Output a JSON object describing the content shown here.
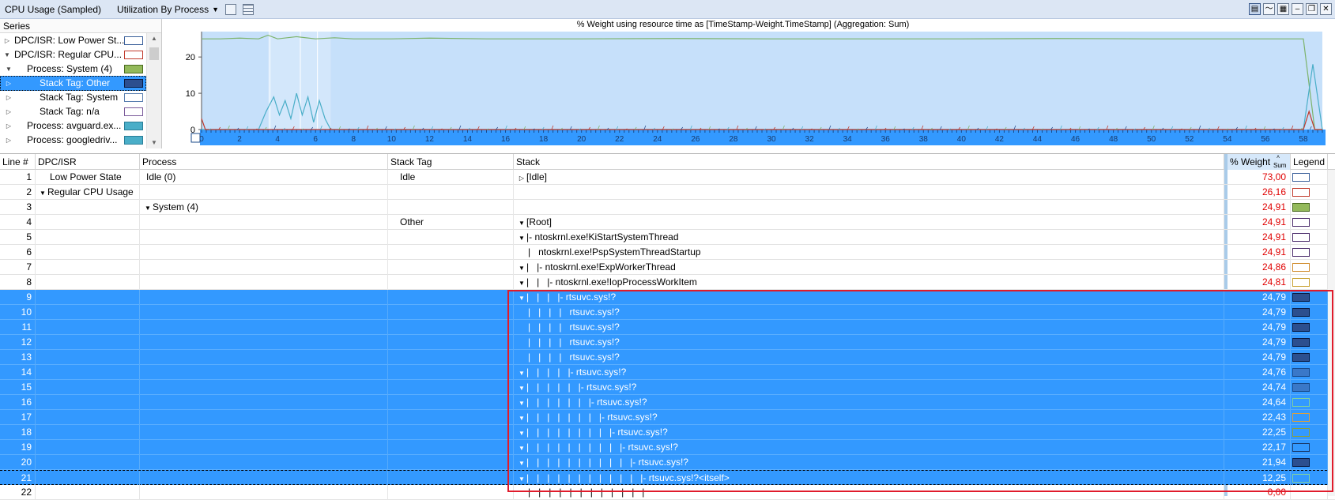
{
  "toolbar": {
    "title": "CPU Usage (Sampled)",
    "view_label": "Utilization By Process",
    "dropdown_glyph": "▼"
  },
  "series_panel": {
    "header": "Series",
    "items": [
      {
        "label": "DPC/ISR: Low Power St...",
        "expander": "▷",
        "indent": 0,
        "swatch": "#ffffff",
        "swatch_border": "#3a5f9a"
      },
      {
        "label": "DPC/ISR: Regular CPU...",
        "expander": "▼",
        "indent": 0,
        "swatch": "#ffffff",
        "swatch_border": "#c0392b"
      },
      {
        "label": "Process: System (4)",
        "expander": "▼",
        "indent": 1,
        "swatch": "#93b95a",
        "swatch_border": "#4a6b20"
      },
      {
        "label": "Stack Tag: Other",
        "expander": "▷",
        "indent": 2,
        "swatch": "#2c4f8f",
        "swatch_border": "#0a1a40",
        "selected": true
      },
      {
        "label": "Stack Tag: System",
        "expander": "▷",
        "indent": 2,
        "swatch": "#ffffff",
        "swatch_border": "#5a7fb0"
      },
      {
        "label": "Stack Tag: n/a",
        "expander": "▷",
        "indent": 2,
        "swatch": "#ffffff",
        "swatch_border": "#7a5a9a"
      },
      {
        "label": "Process: avguard.ex...",
        "expander": "▷",
        "indent": 1,
        "swatch": "#4aaec8",
        "swatch_border": "#2a7e98"
      },
      {
        "label": "Process: googledriv...",
        "expander": "▷",
        "indent": 1,
        "swatch": "#4aaec8",
        "swatch_border": "#2a7e98"
      }
    ]
  },
  "chart_data": {
    "type": "line",
    "title": "% Weight using resource time as [TimeStamp-Weight.TimeStamp] (Aggregation: Sum)",
    "xlabel": "",
    "ylabel": "",
    "xlim": [
      0,
      59
    ],
    "ylim": [
      0,
      27
    ],
    "yticks": [
      0,
      10,
      20
    ],
    "xticks": [
      "0",
      "2",
      "4",
      "6",
      "8",
      "10",
      "12",
      "14",
      "16",
      "18",
      "20",
      "22",
      "24",
      "26",
      "28",
      "30",
      "32",
      "34",
      "36",
      "38",
      "40",
      "42",
      "44",
      "46",
      "48",
      "50",
      "52",
      "54",
      "56",
      "58"
    ],
    "grid": false,
    "series": [
      {
        "color": "#7cb36b",
        "x": [
          0,
          1,
          2,
          3,
          3.5,
          4,
          5,
          6,
          7,
          8,
          10,
          12,
          15,
          20,
          25,
          30,
          35,
          40,
          45,
          50,
          55,
          57,
          58,
          58.6,
          59
        ],
        "values": [
          25,
          25,
          25.2,
          25,
          26,
          25,
          25.6,
          25,
          25.3,
          25,
          25,
          25.2,
          25,
          25,
          25.1,
          25,
          25,
          25,
          25.1,
          25,
          25,
          25,
          25,
          0,
          0
        ]
      },
      {
        "color": "#4aaec8",
        "x": [
          0,
          3,
          3.4,
          3.8,
          4.1,
          4.4,
          4.7,
          5.0,
          5.3,
          5.6,
          5.9,
          6.2,
          6.5,
          6.8,
          7.2,
          10,
          20,
          30,
          40,
          50,
          57,
          58,
          58.5,
          59
        ],
        "values": [
          0,
          0,
          5,
          9,
          4,
          8,
          3,
          10,
          4,
          9,
          2,
          8,
          3,
          0,
          0,
          0,
          0,
          0,
          0,
          0,
          0,
          0,
          18,
          0
        ]
      },
      {
        "color": "#c0392b",
        "x": [
          0,
          0.2,
          0.4,
          58,
          58.3,
          58.6,
          59
        ],
        "values": [
          3,
          0,
          0,
          0,
          5,
          0,
          0
        ]
      }
    ]
  },
  "grid": {
    "columns": [
      "Line #",
      "DPC/ISR",
      "Process",
      "Stack Tag",
      "Stack",
      "% Weight",
      "Legend"
    ],
    "weight_sub": "Sum",
    "rows": [
      {
        "n": "1",
        "dpc": "Low Power State",
        "dpc_exp": "",
        "proc": "Idle (0)",
        "proc_exp": "",
        "tag": "Idle",
        "stack": "[Idle]",
        "stack_exp": "▷",
        "stack_indent": 0,
        "wt": "73,00",
        "legend": "#ffffff",
        "legend_border": "#3a5f9a",
        "sel": false
      },
      {
        "n": "2",
        "dpc": "Regular CPU Usage",
        "dpc_exp": "▼",
        "proc": "",
        "proc_exp": "",
        "tag": "",
        "stack": "",
        "stack_exp": "",
        "stack_indent": 0,
        "wt": "26,16",
        "legend": "#ffffff",
        "legend_border": "#c0392b",
        "sel": false
      },
      {
        "n": "3",
        "dpc": "",
        "dpc_exp": "",
        "proc": "System (4)",
        "proc_exp": "▼",
        "tag": "",
        "stack": "",
        "stack_exp": "",
        "stack_indent": 0,
        "wt": "24,91",
        "legend": "#93b95a",
        "legend_border": "#4a6b20",
        "sel": false
      },
      {
        "n": "4",
        "dpc": "",
        "dpc_exp": "",
        "proc": "",
        "proc_exp": "",
        "tag": "Other",
        "stack": "[Root]",
        "stack_exp": "▼",
        "stack_indent": 0,
        "wt": "24,91",
        "legend": "#ffffff",
        "legend_border": "#4a2a6a",
        "sel": false
      },
      {
        "n": "5",
        "dpc": "",
        "dpc_exp": "",
        "proc": "",
        "proc_exp": "",
        "tag": "",
        "stack": "|- ntoskrnl.exe!KiStartSystemThread",
        "stack_exp": "▼",
        "stack_indent": 0,
        "wt": "24,91",
        "legend": "#ffffff",
        "legend_border": "#4a2a6a",
        "sel": false
      },
      {
        "n": "6",
        "dpc": "",
        "dpc_exp": "",
        "proc": "",
        "proc_exp": "",
        "tag": "",
        "stack": "|   ntoskrnl.exe!PspSystemThreadStartup",
        "stack_exp": "",
        "stack_indent": 0,
        "wt": "24,91",
        "legend": "#ffffff",
        "legend_border": "#4a2a6a",
        "sel": false
      },
      {
        "n": "7",
        "dpc": "",
        "dpc_exp": "",
        "proc": "",
        "proc_exp": "",
        "tag": "",
        "stack": "|   |- ntoskrnl.exe!ExpWorkerThread",
        "stack_exp": "▼",
        "stack_indent": 0,
        "wt": "24,86",
        "legend": "#ffffff",
        "legend_border": "#d08a2a",
        "sel": false
      },
      {
        "n": "8",
        "dpc": "",
        "dpc_exp": "",
        "proc": "",
        "proc_exp": "",
        "tag": "",
        "stack": "|   |   |- ntoskrnl.exe!IopProcessWorkItem",
        "stack_exp": "▼",
        "stack_indent": 0,
        "wt": "24,81",
        "legend": "#ffffff",
        "legend_border": "#c8a030",
        "sel": false
      },
      {
        "n": "9",
        "dpc": "",
        "dpc_exp": "",
        "proc": "",
        "proc_exp": "",
        "tag": "",
        "stack": "|   |   |   |- rtsuvc.sys!?",
        "stack_exp": "▼",
        "stack_indent": 0,
        "wt": "24,79",
        "legend": "#2c4f8f",
        "legend_border": "#0a1a40",
        "sel": true
      },
      {
        "n": "10",
        "dpc": "",
        "dpc_exp": "",
        "proc": "",
        "proc_exp": "",
        "tag": "",
        "stack": "|   |   |   |   rtsuvc.sys!?",
        "stack_exp": "",
        "stack_indent": 0,
        "wt": "24,79",
        "legend": "#2c4f8f",
        "legend_border": "#0a1a40",
        "sel": true
      },
      {
        "n": "11",
        "dpc": "",
        "dpc_exp": "",
        "proc": "",
        "proc_exp": "",
        "tag": "",
        "stack": "|   |   |   |   rtsuvc.sys!?",
        "stack_exp": "",
        "stack_indent": 0,
        "wt": "24,79",
        "legend": "#2c4f8f",
        "legend_border": "#0a1a40",
        "sel": true
      },
      {
        "n": "12",
        "dpc": "",
        "dpc_exp": "",
        "proc": "",
        "proc_exp": "",
        "tag": "",
        "stack": "|   |   |   |   rtsuvc.sys!?",
        "stack_exp": "",
        "stack_indent": 0,
        "wt": "24,79",
        "legend": "#2c4f8f",
        "legend_border": "#0a1a40",
        "sel": true
      },
      {
        "n": "13",
        "dpc": "",
        "dpc_exp": "",
        "proc": "",
        "proc_exp": "",
        "tag": "",
        "stack": "|   |   |   |   rtsuvc.sys!?",
        "stack_exp": "",
        "stack_indent": 0,
        "wt": "24,79",
        "legend": "#2c4f8f",
        "legend_border": "#0a1a40",
        "sel": true
      },
      {
        "n": "14",
        "dpc": "",
        "dpc_exp": "",
        "proc": "",
        "proc_exp": "",
        "tag": "",
        "stack": "|   |   |   |   |- rtsuvc.sys!?",
        "stack_exp": "▼",
        "stack_indent": 0,
        "wt": "24,76",
        "legend": "#3a78c8",
        "legend_border": "#1a4a8a",
        "sel": true
      },
      {
        "n": "15",
        "dpc": "",
        "dpc_exp": "",
        "proc": "",
        "proc_exp": "",
        "tag": "",
        "stack": "|   |   |   |   |   |- rtsuvc.sys!?",
        "stack_exp": "▼",
        "stack_indent": 0,
        "wt": "24,74",
        "legend": "#3a78c8",
        "legend_border": "#1a4a8a",
        "sel": true
      },
      {
        "n": "16",
        "dpc": "",
        "dpc_exp": "",
        "proc": "",
        "proc_exp": "",
        "tag": "",
        "stack": "|   |   |   |   |   |   |- rtsuvc.sys!?",
        "stack_exp": "▼",
        "stack_indent": 0,
        "wt": "24,64",
        "legend": "#3399ff",
        "legend_border": "#7fd0a0",
        "sel": true
      },
      {
        "n": "17",
        "dpc": "",
        "dpc_exp": "",
        "proc": "",
        "proc_exp": "",
        "tag": "",
        "stack": "|   |   |   |   |   |   |   |- rtsuvc.sys!?",
        "stack_exp": "▼",
        "stack_indent": 0,
        "wt": "22,43",
        "legend": "#3399ff",
        "legend_border": "#d8a040",
        "sel": true
      },
      {
        "n": "18",
        "dpc": "",
        "dpc_exp": "",
        "proc": "",
        "proc_exp": "",
        "tag": "",
        "stack": "|   |   |   |   |   |   |   |   |- rtsuvc.sys!?",
        "stack_exp": "▼",
        "stack_indent": 0,
        "wt": "22,25",
        "legend": "#3399ff",
        "legend_border": "#8aa040",
        "sel": true
      },
      {
        "n": "19",
        "dpc": "",
        "dpc_exp": "",
        "proc": "",
        "proc_exp": "",
        "tag": "",
        "stack": "|   |   |   |   |   |   |   |   |   |- rtsuvc.sys!?",
        "stack_exp": "▼",
        "stack_indent": 0,
        "wt": "22,17",
        "legend": "#3399ff",
        "legend_border": "#1a3a6a",
        "sel": true
      },
      {
        "n": "20",
        "dpc": "",
        "dpc_exp": "",
        "proc": "",
        "proc_exp": "",
        "tag": "",
        "stack": "|   |   |   |   |   |   |   |   |   |   |- rtsuvc.sys!?",
        "stack_exp": "▼",
        "stack_indent": 0,
        "wt": "21,94",
        "legend": "#2c4f8f",
        "legend_border": "#0a1a40",
        "sel": true
      },
      {
        "n": "21",
        "dpc": "",
        "dpc_exp": "",
        "proc": "",
        "proc_exp": "",
        "tag": "",
        "stack": "|   |   |   |   |   |   |   |   |   |   |   |- rtsuvc.sys!?<itself>",
        "stack_exp": "▼",
        "stack_indent": 0,
        "wt": "12,25",
        "legend": "#3399ff",
        "legend_border": "#7fd0a0",
        "sel": true,
        "focus": true
      },
      {
        "n": "22",
        "dpc": "",
        "dpc_exp": "",
        "proc": "",
        "proc_exp": "",
        "tag": "",
        "stack": "|   |   |   |   |   |   |   |   |   |   |   |",
        "stack_exp": "",
        "stack_indent": 0,
        "wt": "0,00",
        "legend": "#ffffff",
        "legend_border": "#ffffff",
        "sel": false
      }
    ]
  }
}
